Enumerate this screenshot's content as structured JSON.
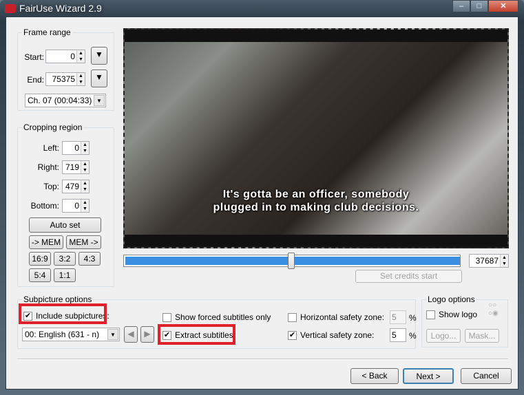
{
  "window": {
    "title": "FairUse Wizard 2.9",
    "icon": "FU",
    "min": "–",
    "max": "□",
    "close": "✕"
  },
  "frame_range": {
    "legend": "Frame range",
    "start_label": "Start:",
    "start": "0",
    "end_label": "End:",
    "end": "75375",
    "chapter": "Ch. 07  (00:04:33)"
  },
  "cropping": {
    "legend": "Cropping region",
    "left_label": "Left:",
    "left": "0",
    "right_label": "Right:",
    "right": "719",
    "top_label": "Top:",
    "top": "479",
    "bottom_label": "Bottom:",
    "bottom": "0",
    "auto_set": "Auto set",
    "to_mem": "-> MEM",
    "from_mem": "MEM ->",
    "ratios": [
      "16:9",
      "3:2",
      "4:3",
      "5:4",
      "1:1"
    ]
  },
  "preview": {
    "subtitle_line1": "It's gotta be an officer, somebody",
    "subtitle_line2": "plugged in to making club decisions.",
    "position": 37687,
    "total": 75375,
    "position_label": "37687",
    "set_credits": "Set credits start"
  },
  "subpicture": {
    "legend": "Subpicture options",
    "include": "Include subpictures:",
    "include_checked": true,
    "stream": "00: English (631 - n)",
    "forced_only": "Show forced subtitles only",
    "forced_checked": false,
    "extract": "Extract subtitles",
    "extract_checked": true,
    "hzone_label": "Horizontal safety zone:",
    "hzone_checked": false,
    "hzone": "5",
    "vzone_label": "Vertical safety zone:",
    "vzone_checked": true,
    "vzone": "5",
    "pct": "%"
  },
  "logo": {
    "legend": "Logo options",
    "show": "Show logo",
    "show_checked": false,
    "logo_btn": "Logo...",
    "mask_btn": "Mask..."
  },
  "nav": {
    "back": "< Back",
    "next": "Next >",
    "cancel": "Cancel"
  }
}
